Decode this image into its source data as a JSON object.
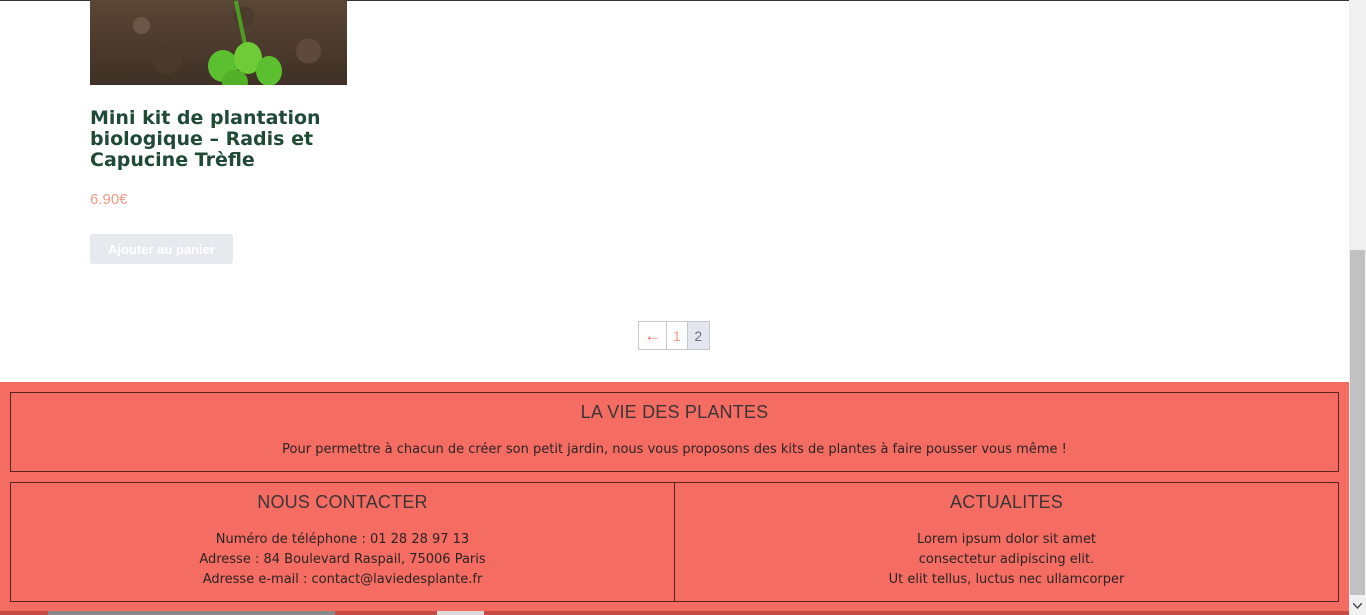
{
  "product": {
    "title": "Mini kit de plantation biologique – Radis et Capucine Trèfle",
    "price": "6.90€",
    "add_to_cart_label": "Ajouter au panier"
  },
  "pagination": {
    "prev": "←",
    "page1": "1",
    "page2": "2",
    "current_page": 2
  },
  "footer": {
    "about": {
      "heading": "LA VIE DES PLANTES",
      "text": "Pour permettre à chacun de créer son petit jardin, nous vous proposons des kits de plantes à faire pousser vous même !"
    },
    "contact": {
      "heading": "NOUS CONTACTER",
      "phone": "Numéro de téléphone : 01 28 28 97 13",
      "address": "Adresse : 84 Boulevard Raspail, 75006 Paris",
      "email": "Adresse e-mail : contact@laviedesplante.fr"
    },
    "news": {
      "heading": "ACTUALITES",
      "line1": "Lorem ipsum dolor sit amet",
      "line2": "consectetur adipiscing elit.",
      "line3": "Ut elit tellus, luctus nec ullamcorper"
    }
  },
  "colors": {
    "footer_bg": "#f56c63",
    "title": "#1f4a35",
    "price": "#f09a86"
  },
  "icons": {
    "scroll_down": "scroll-down-arrow-icon",
    "prev_page": "arrow-left-icon"
  }
}
